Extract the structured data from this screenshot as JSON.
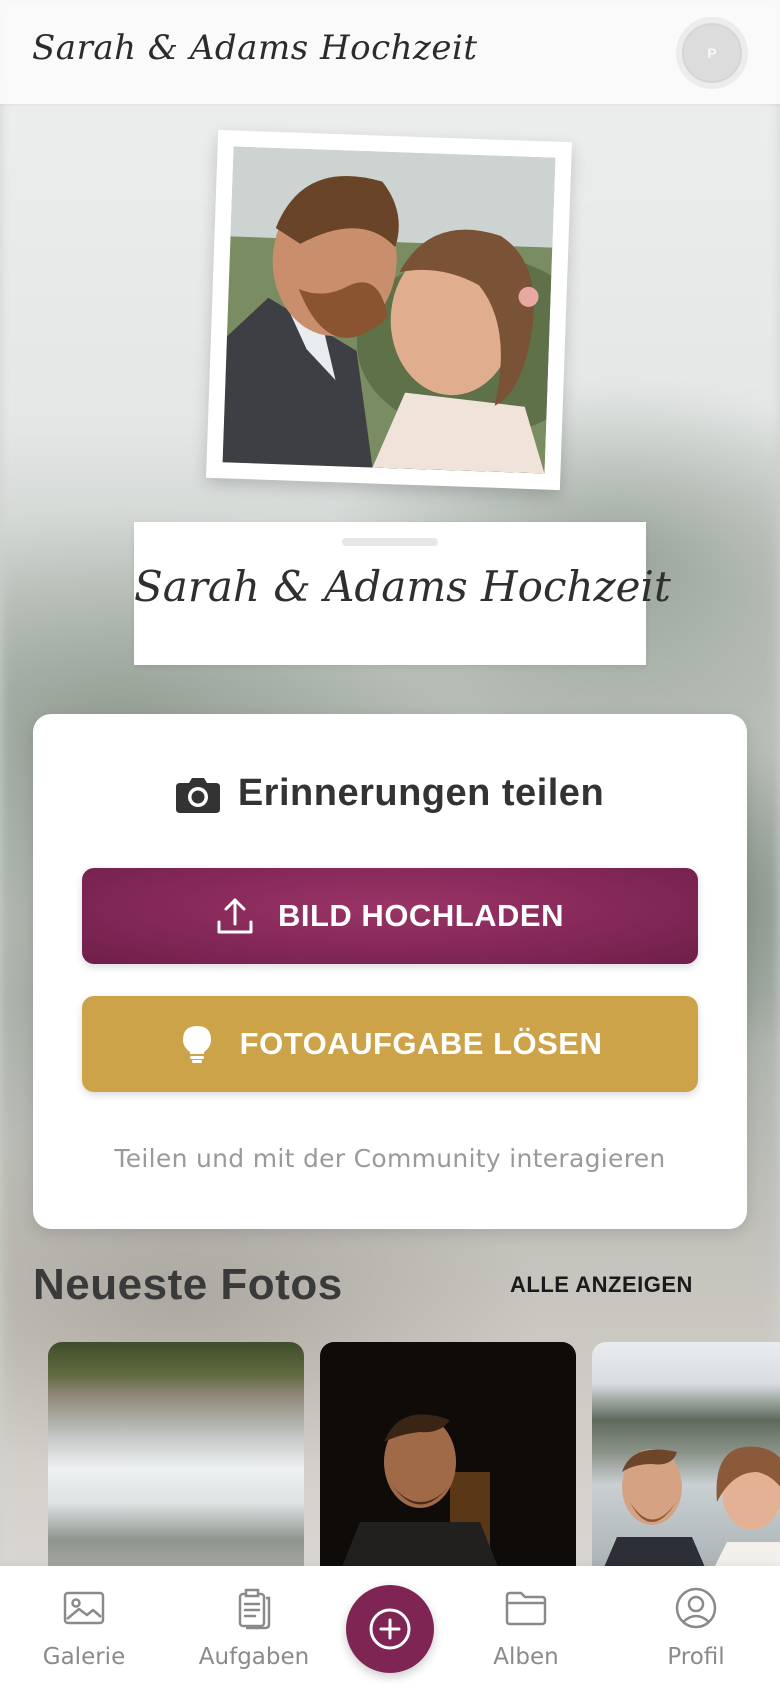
{
  "header": {
    "title": "Sarah & Adams Hochzeit",
    "avatar_initial": "P"
  },
  "hero": {
    "title": "Sarah & Adams Hochzeit"
  },
  "share": {
    "title": "Erinnerungen teilen",
    "upload_label": "BILD HOCHLADEN",
    "task_label": "FOTOAUFGABE LÖSEN",
    "subtitle": "Teilen und mit der Community interagieren"
  },
  "recent": {
    "title": "Neueste Fotos",
    "view_all": "ALLE ANZEIGEN"
  },
  "nav": {
    "gallery": "Galerie",
    "tasks": "Aufgaben",
    "albums": "Alben",
    "profile": "Profil"
  },
  "colors": {
    "primary": "#7f2553",
    "accent_gold": "#cca348",
    "text_dark": "#333333",
    "text_muted": "#9a9a9a"
  },
  "icons": {
    "share_heading": "camera-icon",
    "upload": "upload-icon",
    "task": "lightbulb-icon",
    "gallery": "image-icon",
    "tasks": "clipboard-icon",
    "fab": "plus-circle-icon",
    "albums": "folder-icon",
    "profile": "user-circle-icon"
  }
}
